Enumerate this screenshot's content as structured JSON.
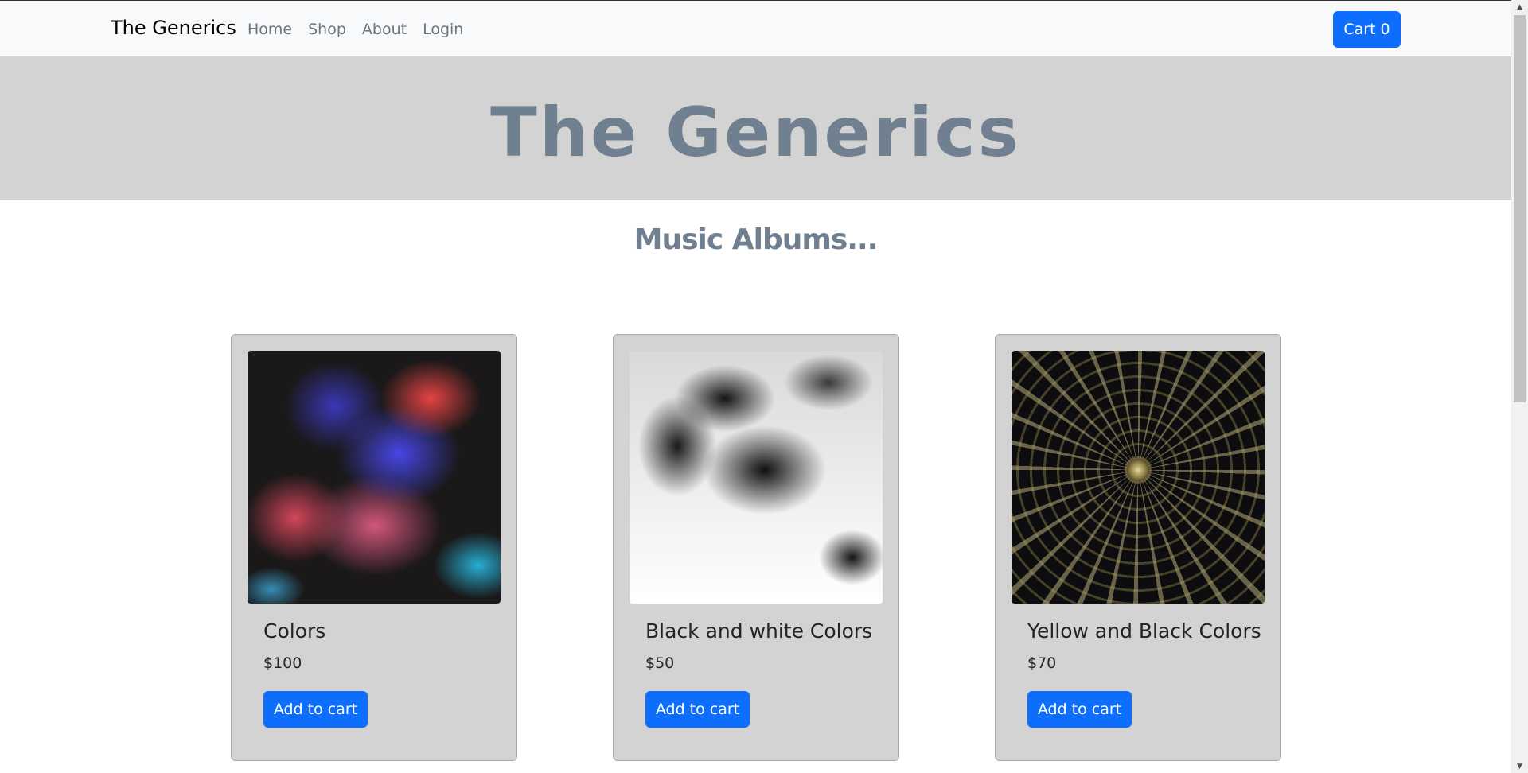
{
  "navbar": {
    "brand": "The Generics",
    "links": [
      "Home",
      "Shop",
      "About",
      "Login"
    ],
    "cart_label": "Cart 0"
  },
  "hero": {
    "title": "The Generics"
  },
  "section": {
    "title": "Music Albums..."
  },
  "products": [
    {
      "title": "Colors",
      "price": "$100",
      "button": "Add to cart",
      "image": "colorful-smoke-image"
    },
    {
      "title": "Black and white Colors",
      "price": "$50",
      "button": "Add to cart",
      "image": "black-ink-image"
    },
    {
      "title": "Yellow and Black Colors",
      "price": "$70",
      "button": "Add to cart",
      "image": "radial-ceiling-image"
    }
  ],
  "colors": {
    "primary": "#0d6efd",
    "hero_bg": "#d3d3d3",
    "title_text": "#708090",
    "card_bg": "#d3d3d3"
  }
}
